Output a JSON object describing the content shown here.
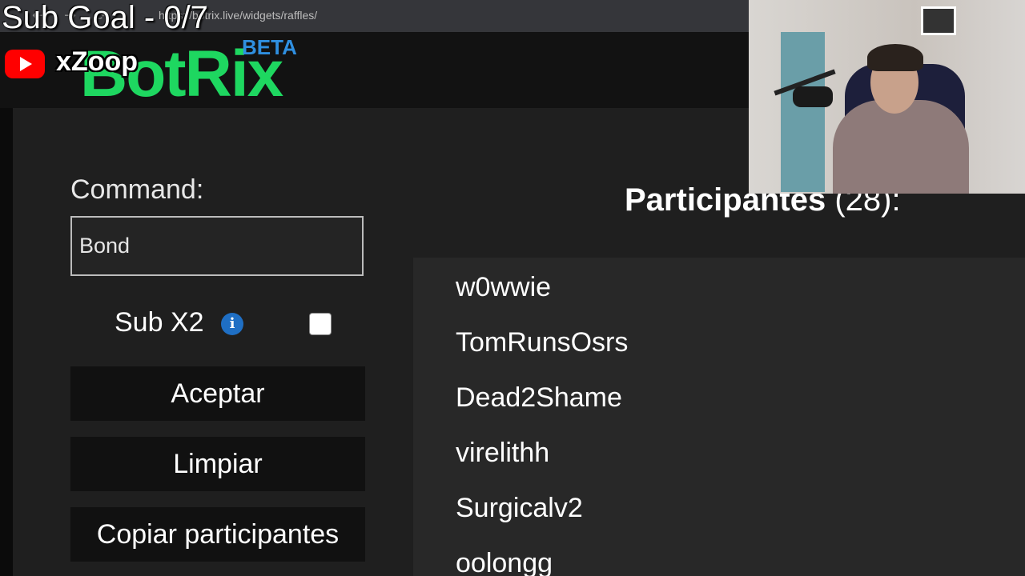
{
  "browser": {
    "url": "https://botrix.live/widgets/raffles/"
  },
  "logo": {
    "text": "BotRix",
    "badge": "BETA"
  },
  "overlay": {
    "sub_goal": "Sub Goal - 0/7",
    "channel_name": "xZoop",
    "channel_icon": "youtube-icon"
  },
  "form": {
    "command_label": "Command:",
    "command_value": "Bond",
    "sub_label": "Sub X2",
    "info_icon": "info-icon",
    "sub_checked": false,
    "accept_label": "Aceptar",
    "clear_label": "Limpiar",
    "copy_label": "Copiar participantes"
  },
  "participants": {
    "title": "Participantes",
    "count": "(28):",
    "items": [
      "w0wwie",
      "TomRunsOsrs",
      "Dead2Shame",
      "virelithh",
      "Surgicalv2",
      "oolongg"
    ]
  },
  "colors": {
    "brand": "#1ed760",
    "beta": "#2f8fe0",
    "youtube": "#ff0000"
  }
}
